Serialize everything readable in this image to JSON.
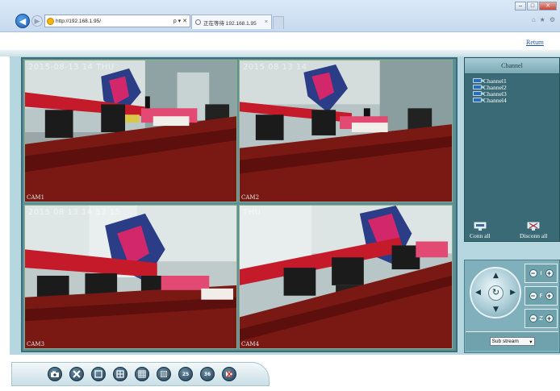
{
  "browser": {
    "address_url": "http://192.168.1.95/",
    "address_controls": "ρ ▾ ✕",
    "tab_title": "正在等待 192.168.1.95",
    "tab_close": "×"
  },
  "page": {
    "return_label": "Return"
  },
  "cameras": [
    {
      "osd": "2015-08-13 14",
      "osd2": "THU",
      "label": "CAM1"
    },
    {
      "osd": "2015 08 13 14",
      "osd2": "",
      "label": "CAM2"
    },
    {
      "osd": "2015 08 13 14 53 15",
      "osd2": "",
      "label": "CAM3"
    },
    {
      "osd": "",
      "osd2": "THU",
      "label": "CAM4"
    }
  ],
  "channel_panel": {
    "title": "Channel",
    "channels": [
      "Channel1",
      "Channel2",
      "Channel3",
      "Channel4"
    ],
    "connect_all_label": "Conn all",
    "disconnect_all_label": "Disconn all"
  },
  "ptz": {
    "iris_letter": "I",
    "focus_letter": "F",
    "zoom_letter": "Z",
    "minus_glyph": "−",
    "plus_glyph": "+",
    "center_glyph": "↻"
  },
  "stream": {
    "selected": "Sub stream"
  },
  "toolbar": {
    "layout_25_label": "25",
    "layout_36_label": "36"
  },
  "colors": {
    "panel_dark": "#396a75",
    "panel_light": "#7fb0bb",
    "frame": "#5d8f99",
    "toolbar_button": "#1f3d57"
  }
}
